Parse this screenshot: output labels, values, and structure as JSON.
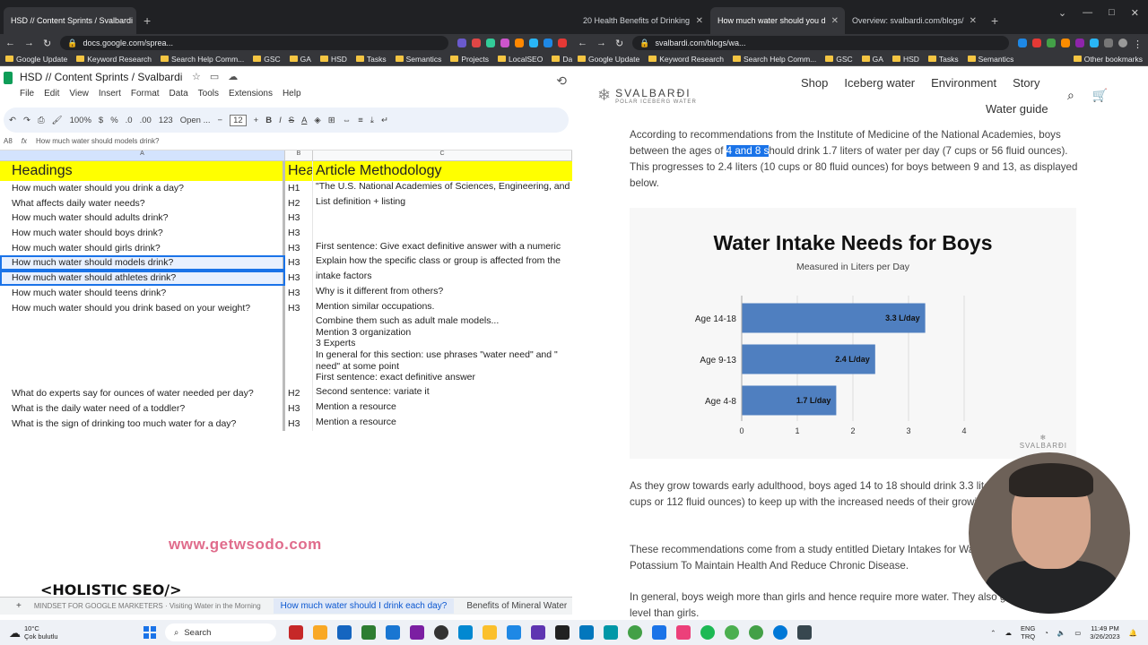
{
  "left_browser": {
    "tabs": [
      {
        "label": "HSD // Content Sprints / Svalbardi"
      }
    ],
    "url": "docs.google.com/sprea...",
    "bookmarks": [
      "Google Update",
      "Keyword Research",
      "Search Help Comm...",
      "GSC",
      "GA",
      "HSD",
      "Tasks",
      "Semantics",
      "Projects",
      "LocalSEO",
      "Daily"
    ]
  },
  "right_browser": {
    "tabs": [
      {
        "label": "20 Health Benefits of Drinking"
      },
      {
        "label": "How much water should you d"
      },
      {
        "label": "Overview: svalbardi.com/blogs/"
      }
    ],
    "url": "svalbardi.com/blogs/wa...",
    "bookmarks": [
      "Google Update",
      "Keyword Research",
      "Search Help Comm...",
      "GSC",
      "GA",
      "HSD",
      "Tasks",
      "Semantics",
      "Other bookmarks"
    ]
  },
  "sheet": {
    "title": "HSD // Content Sprints / Svalbardi",
    "menu": [
      "File",
      "Edit",
      "View",
      "Insert",
      "Format",
      "Data",
      "Tools",
      "Extensions",
      "Help"
    ],
    "toolbar": {
      "zoom": "100%",
      "currency": "$",
      "percent": "%",
      "dec_less": ".0",
      "dec_more": ".00",
      "num": "123",
      "font": "Open ...",
      "font_size": "12"
    },
    "cell_ref": "A8",
    "formula": "How much water should models drink?",
    "columns": [
      "A",
      "B",
      "C"
    ],
    "header": {
      "a": "Headings",
      "b": "Hea",
      "c": "Article Methodology"
    },
    "rows": [
      {
        "a": "How much water should you drink a day?",
        "b": "H1",
        "c": "\"The U.S. National Academies of Sciences, Engineering, and"
      },
      {
        "a": "What affects daily water needs?",
        "b": "H2",
        "c": "List definition + listing"
      },
      {
        "a": "How much water should adults drink?",
        "b": "H3",
        "c": ""
      },
      {
        "a": "How much water should boys drink?",
        "b": "H3",
        "c": ""
      },
      {
        "a": "How much water should girls drink?",
        "b": "H3",
        "c": "First sentence: Give exact definitive answer with a numeric"
      },
      {
        "a": "How much water should models drink?",
        "b": "H3",
        "c": "Explain how the specific class or group is affected from the",
        "selected": true
      },
      {
        "a": "How much water should athletes drink?",
        "b": "H3",
        "c": "intake factors",
        "selected": true
      },
      {
        "a": "How much water should teens drink?",
        "b": "H3",
        "c": "Why is it different from others?"
      },
      {
        "a": "How much water should you drink based on your weight?",
        "b": "H3",
        "c": "Mention similar occupations."
      }
    ],
    "method_block": [
      "Combine them such as adult male models...",
      "Mention 3 organization",
      "3 Experts",
      "In general for this section: use phrases \"water need\" and \"",
      "need\" at some point",
      "First sentence: exact definitive answer"
    ],
    "rows2": [
      {
        "a": "What do experts say for ounces of water needed per day?",
        "b": "H2",
        "c": "Second sentence: variate it"
      },
      {
        "a": "What is the daily water need of a toddler?",
        "b": "H3",
        "c": "Mention a resource"
      },
      {
        "a": "What is the sign of drinking too much water for a day?",
        "b": "H3",
        "c": "Mention a resource"
      }
    ],
    "sheet_tabs": [
      "Visiting Water in the Morning",
      "How much water should I drink each day?",
      "Benefits of Mineral Water"
    ],
    "watermark": "www.getwsodo.com",
    "brand": "<HOLISTIC SEO/>",
    "brand_sub": "MINDSET FOR GOOGLE MARKETERS"
  },
  "site": {
    "logo": {
      "name": "SVALBARÐI",
      "tagline": "POLAR ICEBERG WATER"
    },
    "nav": [
      "Shop",
      "Iceberg water",
      "Environment",
      "Story"
    ],
    "nav2": "Water guide",
    "para1_a": "According to recommendations from the Institute of Medicine of the National Academies, boys between the ages of ",
    "para1_hl": "4 and 8 s",
    "para1_b": "hould drink 1.7 liters of water per day (7 cups or 56 fluid ounces). This progresses to 2.4 liters (10 cups or 80 fluid ounces) for boys between 9 and 13, as displayed below.",
    "para2": "As they grow towards early adulthood, boys aged 14 to 18 should drink 3.3 liters per day (14 cups or 112 fluid ounces) to keep up with the increased needs of their growing bodies.",
    "para3": "These recommendations come from a study entitled Dietary Intakes for Water, Salt, And Potassium To Maintain Health And Reduce Chronic Disease.",
    "para4": "In general, boys weigh more than girls and hence require more water. They also grow at a faster level than girls.",
    "chart_logo": "SVALBARÐI"
  },
  "chart_data": {
    "type": "bar",
    "orientation": "horizontal",
    "title": "Water Intake Needs for Boys",
    "subtitle": "Measured in Liters per Day",
    "categories": [
      "Age 14-18",
      "Age 9-13",
      "Age 4-8"
    ],
    "values": [
      3.3,
      2.4,
      1.7
    ],
    "labels": [
      "3.3 L/day",
      "2.4 L/day",
      "1.7 L/day"
    ],
    "xlim": [
      0,
      4
    ],
    "xticks": [
      "0",
      "1",
      "2",
      "3",
      "4"
    ],
    "grid": true,
    "bar_color": "#4f7fc0"
  },
  "taskbar": {
    "weather_temp": "10°C",
    "weather_desc": "Çok bulutlu",
    "search": "Search",
    "lang": "ENG",
    "lang2": "TRQ",
    "time": "11:49 PM",
    "date": "3/26/2023"
  }
}
